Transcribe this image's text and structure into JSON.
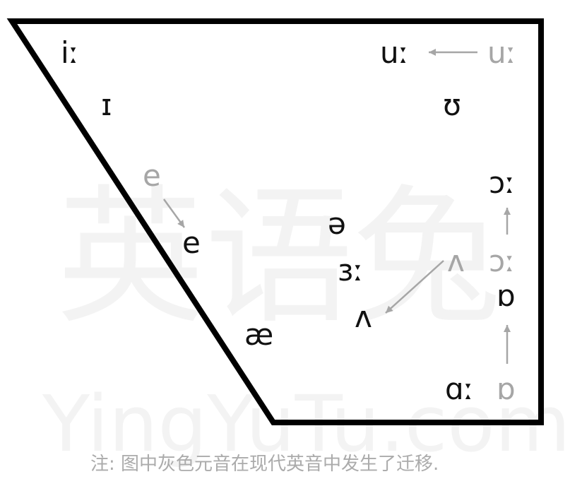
{
  "watermark": {
    "chinese": "英语兔",
    "latin": "YingYuTu.com"
  },
  "vowels": {
    "i_long": "iː",
    "u_long": "uː",
    "u_long_old": "uː",
    "short_i": "ɪ",
    "short_u": "ʊ",
    "e_old": "e",
    "e_new": "e",
    "open_o_long": "ɔː",
    "open_o_long_old": "ɔː",
    "schwa": "ə",
    "er_long": "ɜː",
    "wedge_old": "ʌ",
    "wedge_new": "ʌ",
    "short_o": "ɒ",
    "ae": "æ",
    "a_long": "ɑː",
    "short_o_old": "ɒ"
  },
  "colors": {
    "current": "#111111",
    "old": "#a6a6a6",
    "arrow": "#a6a6a6",
    "outline": "#000000"
  },
  "note": "注: 图中灰色元音在现代英音中发生了迁移."
}
